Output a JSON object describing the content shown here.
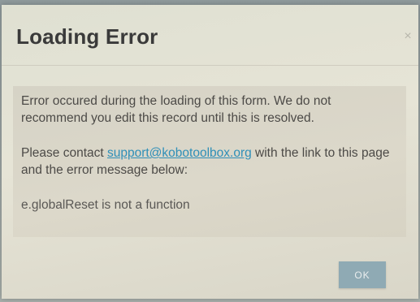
{
  "dialog": {
    "title": "Loading Error",
    "close_symbol": "×",
    "message_line1": "Error occured during the loading of this form. We do not",
    "message_line2": "recommend you edit this record until this is resolved.",
    "contact_prefix": "Please contact ",
    "support_email": "support@kobotoolbox.org",
    "contact_suffix": " with the link to this page",
    "contact_line2": "and the error message below:",
    "error_message": "e.globalReset is not a function",
    "ok_label": "OK"
  },
  "colors": {
    "link": "#2f8fb8",
    "ok_button": "#8faab4",
    "title_text": "#3a3a3a"
  }
}
